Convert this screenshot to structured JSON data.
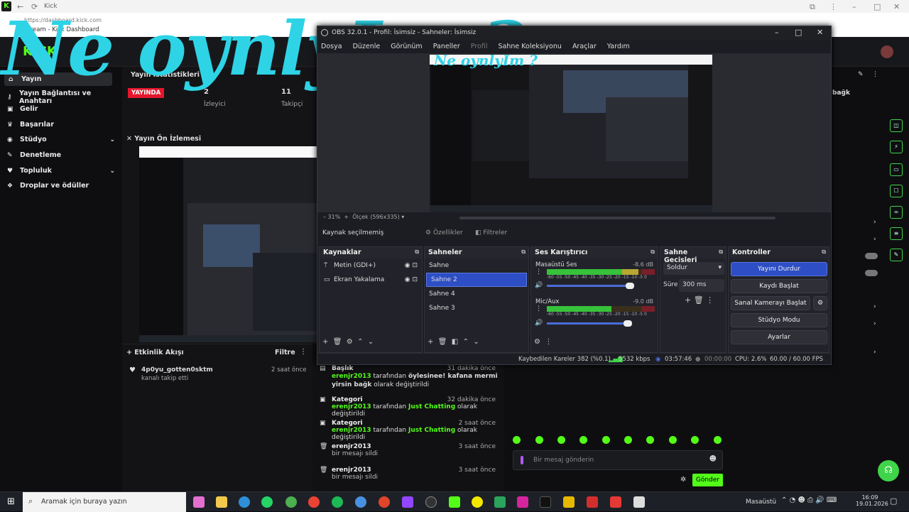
{
  "browser": {
    "tab": "Kick",
    "url": "https://dashboard.kick.com",
    "page_title": "Stream - Kick Dashboard"
  },
  "overlay": {
    "text": "Ne oynlyIm ?"
  },
  "sidebar": {
    "items": [
      {
        "label": "Yayın",
        "icon": "home-icon"
      },
      {
        "label": "Yayın Bağlantısı ve Anahtarı",
        "icon": "key-icon"
      },
      {
        "label": "Gelir",
        "icon": "money-icon"
      },
      {
        "label": "Başarılar",
        "icon": "trophy-icon"
      },
      {
        "label": "Stüdyo",
        "icon": "studio-icon"
      },
      {
        "label": "Denetleme",
        "icon": "wrench-icon"
      },
      {
        "label": "Topluluk",
        "icon": "community-icon"
      },
      {
        "label": "Droplar ve ödüller",
        "icon": "gift-icon"
      }
    ]
  },
  "stats": {
    "title": "Yayın İstatistikleri",
    "live_badge": "YAYINDA",
    "viewers_value": "2",
    "viewers_label": "İzleyici",
    "followers_value": "11",
    "followers_label": "Takipçi"
  },
  "stream_preview": {
    "title": "Yayın Ön İzlemesi"
  },
  "activity": {
    "title": "Etkinlik Akışı",
    "filter_label": "Filtre",
    "items": [
      {
        "user": "4p0yu_gotten0sktm",
        "desc": "kanalı takip etti",
        "time": "2 saat önce"
      }
    ]
  },
  "modlog": [
    {
      "title": "Başlık",
      "time": "31 dakika önce",
      "user": "erenjr2013",
      "mid": "tarafından",
      "value": "öylesinee! kafana mermi yirsin bağk",
      "tail": "olarak değiştirildi"
    },
    {
      "title": "Kategori",
      "time": "32 dakika önce",
      "user": "erenjr2013",
      "mid": "tarafından",
      "value": "Just Chatting",
      "tail": "olarak değiştirildi"
    },
    {
      "title": "Kategori",
      "time": "2 saat önce",
      "user": "erenjr2013",
      "mid": "tarafından",
      "value": "Just Chatting",
      "tail": "olarak değiştirildi"
    },
    {
      "title": "erenjr2013",
      "time": "3 saat önce",
      "desc": "bir mesajı sildi"
    },
    {
      "title": "erenjr2013",
      "time": "3 saat önce",
      "desc": "bir mesajı sildi"
    }
  ],
  "chat": {
    "placeholder": "Bir mesaj gönderin",
    "send_label": "Gönder"
  },
  "rightrail": {
    "label": "bağk"
  },
  "obs": {
    "title": "OBS 32.0.1 - Profil: İsimsiz - Sahneler: İsimsiz",
    "menu": [
      "Dosya",
      "Düzenle",
      "Görünüm",
      "Paneller",
      "Profil",
      "Sahne Koleksiyonu",
      "Araçlar",
      "Yardım"
    ],
    "zoom": "31%",
    "scale": "Ölçek (596x335)",
    "no_source": "Kaynak seçilmemiş",
    "properties": "Özellikler",
    "filters": "Filtreler",
    "sources_title": "Kaynaklar",
    "sources": [
      "Metin (GDI+)",
      "Ekran Yakalama"
    ],
    "scenes_title": "Sahneler",
    "scenes": [
      "Sahne",
      "Sahne 2",
      "Sahne 4",
      "Sahne 3"
    ],
    "mixer_title": "Ses Karıştırıcı",
    "mixer": [
      {
        "name": "Masaüstü Ses",
        "db": "-8.6 dB",
        "level": 0.85,
        "volume": 0.8
      },
      {
        "name": "Mic/Aux",
        "db": "-9.0 dB",
        "level": 0.6,
        "volume": 0.78
      }
    ],
    "meter_ticks": [
      "-60",
      "-55",
      "-50",
      "-45",
      "-40",
      "-35",
      "-30",
      "-25",
      "-20",
      "-15",
      "-10",
      "-5",
      "0"
    ],
    "transitions_title": "Sahne Geçişleri",
    "transition": "Soldur",
    "duration_label": "Süre",
    "duration": "300 ms",
    "controls_title": "Kontroller",
    "controls": [
      "Yayını Durdur",
      "Kaydı Başlat",
      "Sanal Kamerayı Başlat",
      "Stüdyo Modu",
      "Ayarlar"
    ],
    "status": {
      "dropped": "Kaybedilen Kareler 382 (%0.1)",
      "bitrate": "5532 kbps",
      "stream_time": "03:57:46",
      "rec_time": "00:00:00",
      "cpu": "CPU: 2.6%",
      "fps": "60.00 / 60.00 FPS"
    }
  },
  "taskbar": {
    "search": "Aramak için buraya yazın",
    "desktop": "Masaüstü",
    "time": "16:09",
    "date": "19.01.2026"
  },
  "colors": {
    "kick_green": "#53fc18",
    "obs_blue": "#2d4ec5",
    "overlay_cyan": "#2ed3e6"
  }
}
